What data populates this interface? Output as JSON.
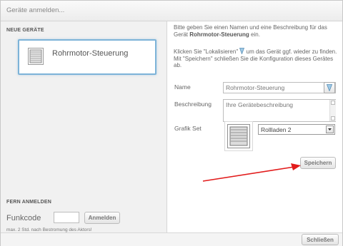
{
  "dialog": {
    "title": "Geräte anmelden..."
  },
  "left": {
    "new_devices_heading": "NEUE GERÄTE",
    "device_card": {
      "name": "Rohrmotor-Steuerung",
      "icon": "roller-shutter-icon"
    },
    "remote_heading": "FERN ANMELDEN",
    "funkcode_label": "Funkcode",
    "funkcode_value": "",
    "register_button": "Anmelden",
    "hint": "max. 2 Std. nach Bestromung des Aktors!"
  },
  "right": {
    "intro_prefix": "Bitte geben Sie einen Namen und eine Beschreibung für das Gerät ",
    "intro_device": "Rohrmotor-Steuerung",
    "intro_suffix": " ein.",
    "localize_prefix": "Klicken Sie \"Lokalisieren\" ",
    "localize_suffix": " um das Gerät ggf. wieder zu finden. Mit \"Speichern\" schließen Sie die Konfiguration dieses Gerätes ab.",
    "name_label": "Name",
    "name_value": "Rohrmotor-Steuerung",
    "description_label": "Beschreibung",
    "description_placeholder": "Ihre Gerätebeschreibung",
    "graphic_set_label": "Grafik Set",
    "graphic_set_selected": "Rollladen 2",
    "save_button": "Speichern",
    "localize_icon": "locate-icon"
  },
  "footer": {
    "close_button": "Schließen"
  },
  "colors": {
    "accent_border": "#7db3d8",
    "annotation_arrow": "#e21b1b"
  }
}
